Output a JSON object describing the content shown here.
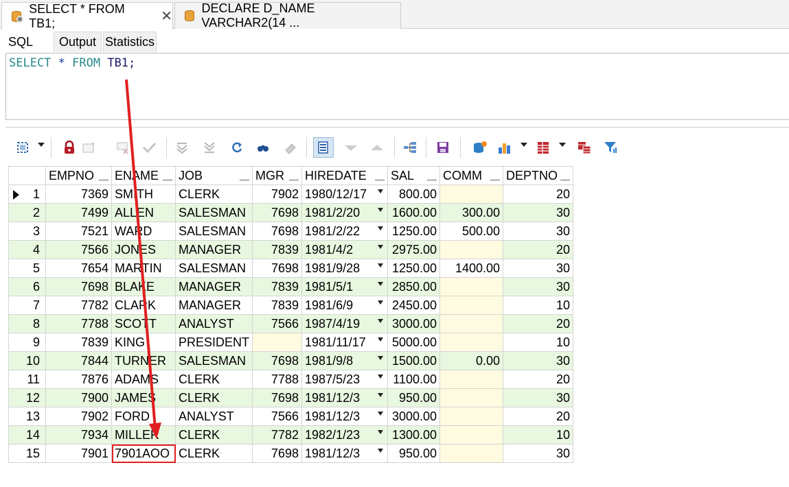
{
  "editor_tabs": [
    {
      "label": "SELECT * FROM TB1;",
      "close": "✕"
    },
    {
      "label": "DECLARE D_NAME VARCHAR2(14 ..."
    }
  ],
  "sub_tabs": {
    "sql": "SQL",
    "output": "Output",
    "statistics": "Statistics"
  },
  "sql": {
    "keyword1": "SELECT",
    "star": " * ",
    "keyword2": "FROM",
    "table": " TB1;"
  },
  "toolbar_icons": [
    "grid-select-icon",
    "lock-icon",
    "insert-row-icon",
    "delete-row-icon",
    "commit-check-icon",
    "first-record-icon",
    "last-record-icon",
    "refresh-icon",
    "find-icon",
    "eraser-icon",
    "form-view-icon",
    "sort-desc-icon",
    "sort-asc-icon",
    "tree-icon",
    "save-icon",
    "db-export-icon",
    "chart-icon",
    "columns-icon",
    "compare-icon",
    "filter-icon"
  ],
  "grid": {
    "columns": [
      "EMPNO",
      "ENAME",
      "JOB",
      "MGR",
      "HIREDATE",
      "SAL",
      "COMM",
      "DEPTNO"
    ],
    "rows": [
      [
        "1",
        "7369",
        "SMITH",
        "CLERK",
        "7902",
        "1980/12/17",
        "800.00",
        "",
        "20"
      ],
      [
        "2",
        "7499",
        "ALLEN",
        "SALESMAN",
        "7698",
        "1981/2/20",
        "1600.00",
        "300.00",
        "30"
      ],
      [
        "3",
        "7521",
        "WARD",
        "SALESMAN",
        "7698",
        "1981/2/22",
        "1250.00",
        "500.00",
        "30"
      ],
      [
        "4",
        "7566",
        "JONES",
        "MANAGER",
        "7839",
        "1981/4/2",
        "2975.00",
        "",
        "20"
      ],
      [
        "5",
        "7654",
        "MARTIN",
        "SALESMAN",
        "7698",
        "1981/9/28",
        "1250.00",
        "1400.00",
        "30"
      ],
      [
        "6",
        "7698",
        "BLAKE",
        "MANAGER",
        "7839",
        "1981/5/1",
        "2850.00",
        "",
        "30"
      ],
      [
        "7",
        "7782",
        "CLARK",
        "MANAGER",
        "7839",
        "1981/6/9",
        "2450.00",
        "",
        "10"
      ],
      [
        "8",
        "7788",
        "SCOTT",
        "ANALYST",
        "7566",
        "1987/4/19",
        "3000.00",
        "",
        "20"
      ],
      [
        "9",
        "7839",
        "KING",
        "PRESIDENT",
        "",
        "1981/11/17",
        "5000.00",
        "",
        "10"
      ],
      [
        "10",
        "7844",
        "TURNER",
        "SALESMAN",
        "7698",
        "1981/9/8",
        "1500.00",
        "0.00",
        "30"
      ],
      [
        "11",
        "7876",
        "ADAMS",
        "CLERK",
        "7788",
        "1987/5/23",
        "1100.00",
        "",
        "20"
      ],
      [
        "12",
        "7900",
        "JAMES",
        "CLERK",
        "7698",
        "1981/12/3",
        "950.00",
        "",
        "30"
      ],
      [
        "13",
        "7902",
        "FORD",
        "ANALYST",
        "7566",
        "1981/12/3",
        "3000.00",
        "",
        "20"
      ],
      [
        "14",
        "7934",
        "MILLER",
        "CLERK",
        "7782",
        "1982/1/23",
        "1300.00",
        "",
        "10"
      ],
      [
        "15",
        "7901",
        "7901AOO",
        "CLERK",
        "7698",
        "1981/12/3",
        "950.00",
        "",
        "30"
      ]
    ]
  },
  "colors": {
    "even_row": "#e8f8e0",
    "null_cell": "#fffbe0",
    "annotation": "#e02020",
    "sql_keyword": "#2a8a8a"
  }
}
